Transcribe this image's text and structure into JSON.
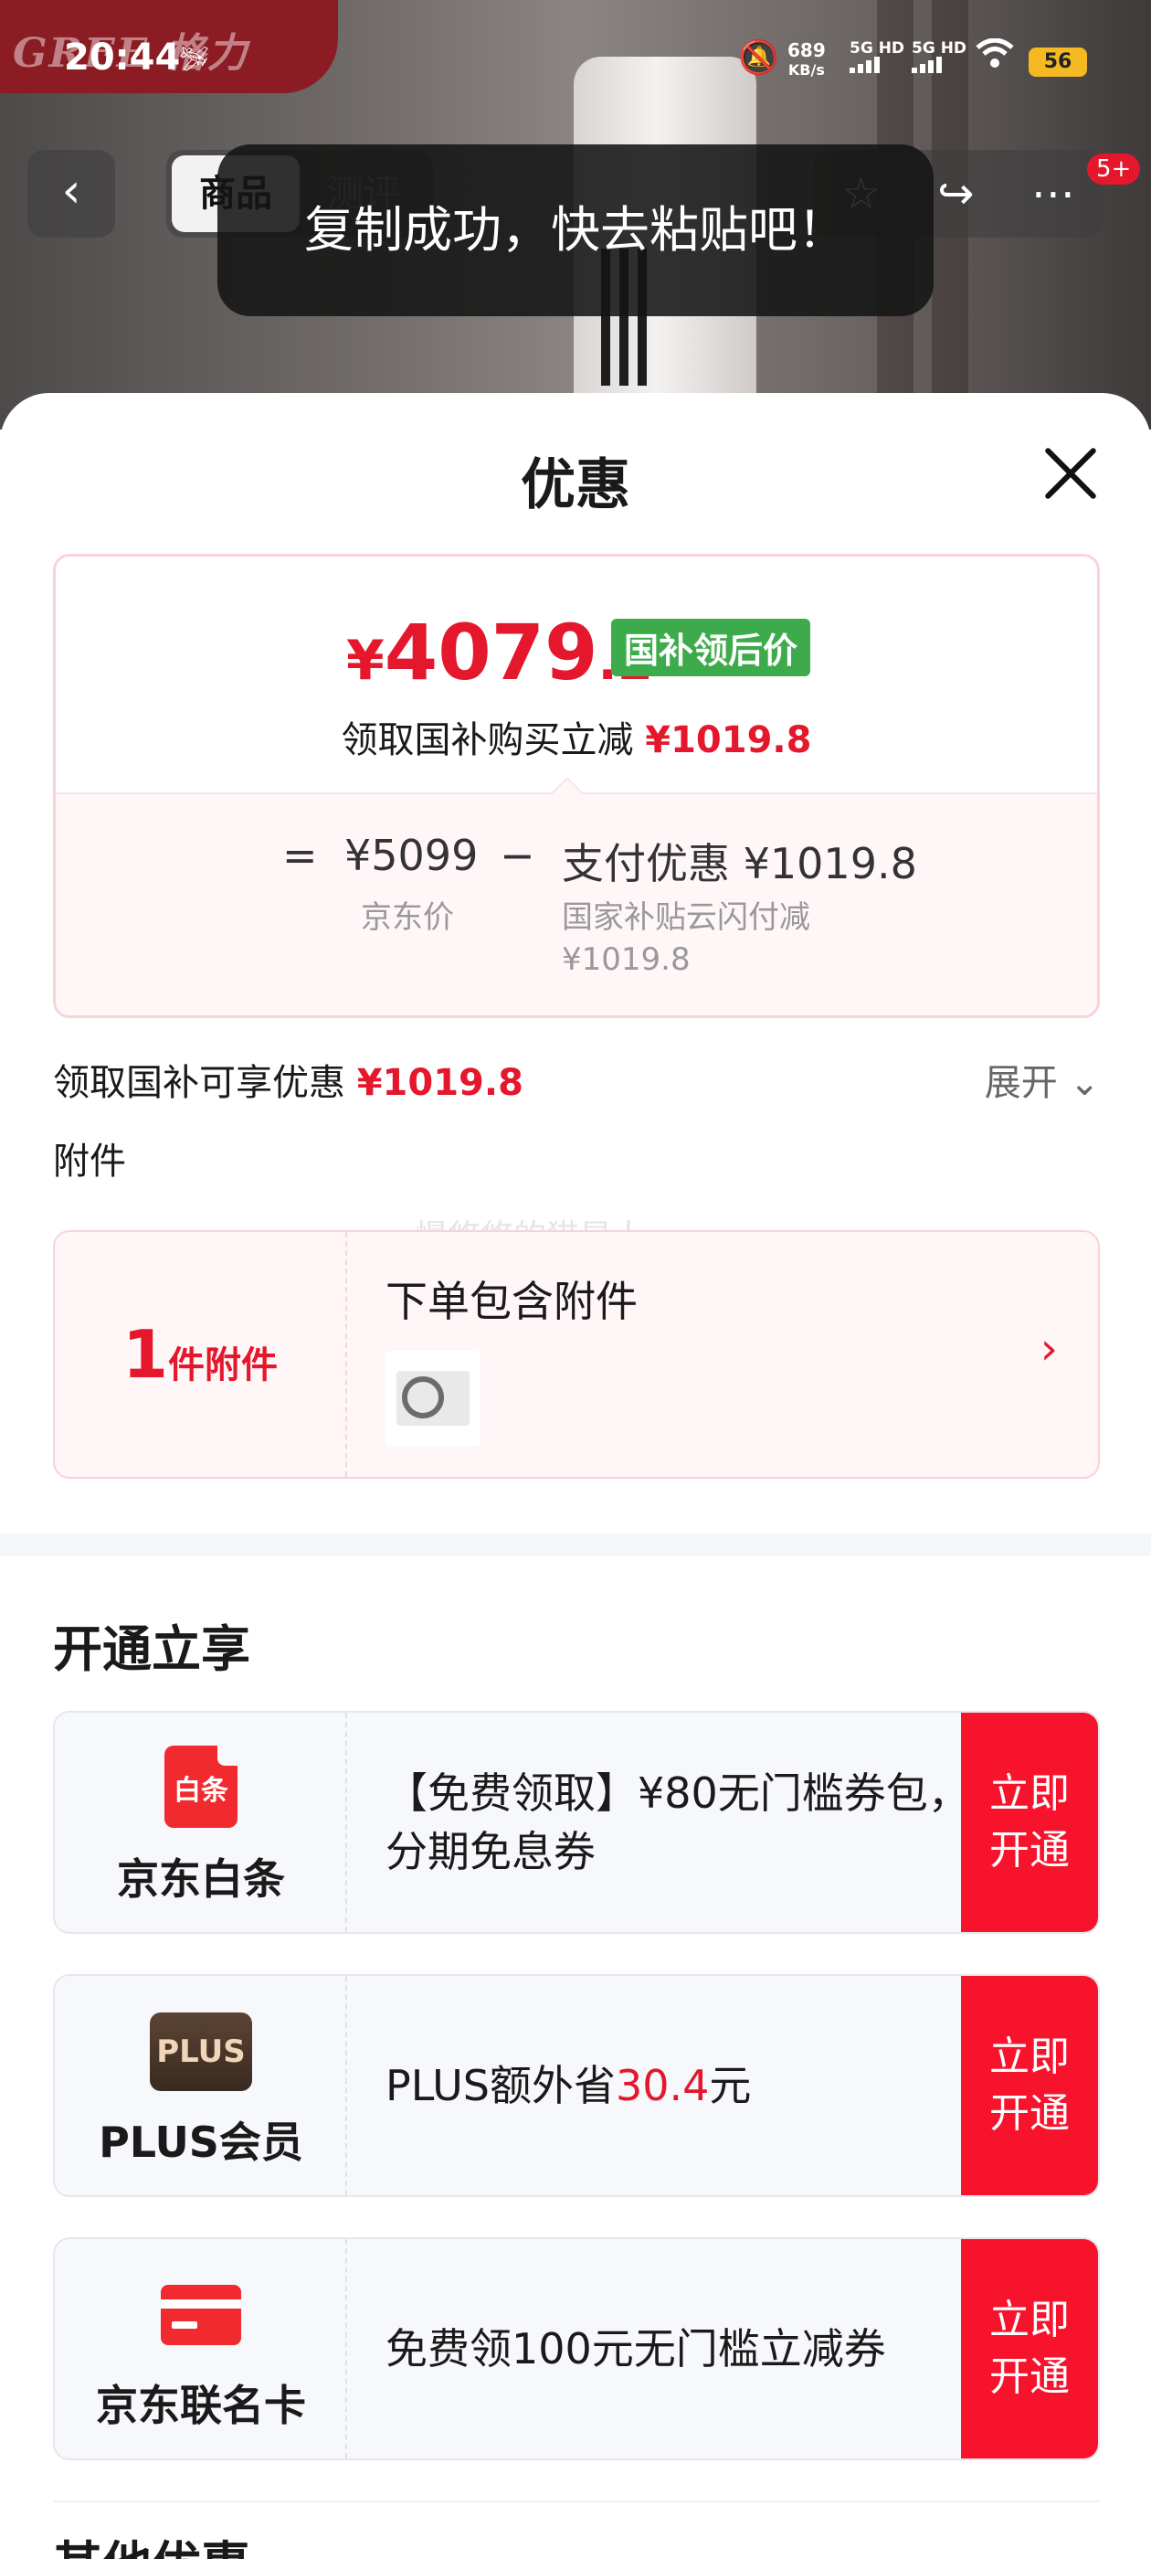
{
  "status_bar": {
    "time": "20:44",
    "net_speed_value": "689",
    "net_speed_unit": "KB/s",
    "sim1": "5G HD",
    "sim2": "5G HD",
    "battery": "56"
  },
  "background": {
    "brand_logo_text": "GREE 格力"
  },
  "nav": {
    "tabs": [
      "商品",
      "测评"
    ],
    "more_badge": "5+"
  },
  "toast": {
    "message": "复制成功，快去粘贴吧！"
  },
  "sheet": {
    "title": "优惠",
    "price_card": {
      "currency": "¥",
      "price_int": "4079",
      "price_dec": ".2",
      "tag": "国补领后价",
      "reduce_text": "领取国补购买立减",
      "reduce_amount": "¥1019.8",
      "calc": {
        "equals": "=",
        "jd_price": "¥5099",
        "minus": "−",
        "payment_label": "支付优惠 ¥1019.8",
        "jd_price_label": "京东价",
        "subsidy_line1": "国家补贴云闪付减",
        "subsidy_line2": "¥1019.8"
      }
    },
    "subsidy_row": {
      "label": "领取国补可享优惠",
      "amount": "¥1019.8",
      "expand": "展开"
    },
    "attachments": {
      "label": "附件",
      "watermark": "慢悠悠的猫星人",
      "count": "1",
      "unit": "件附件",
      "title": "下单包含附件"
    },
    "open_section": {
      "title": "开通立享",
      "offers": [
        {
          "brand_icon_text": "白条",
          "brand": "京东白条",
          "desc": "【免费领取】¥80无门槛券包，分期免息券",
          "desc_highlight": "",
          "desc_suffix": "",
          "cta": "立即开通"
        },
        {
          "brand_icon_text": "PLUS",
          "brand": "PLUS会员",
          "desc": "PLUS额外省",
          "desc_highlight": "30.4",
          "desc_suffix": "元",
          "cta": "立即开通"
        },
        {
          "brand_icon_text": "",
          "brand": "京东联名卡",
          "desc": "免费领100元无门槛立减券",
          "desc_highlight": "",
          "desc_suffix": "",
          "cta": "立即开通"
        }
      ]
    },
    "next_section_title": "其他优惠"
  },
  "icons": {
    "back": "back-arrow-icon",
    "favorite": "star-icon",
    "share": "share-icon",
    "more": "more-dots-icon",
    "close": "close-icon",
    "expand": "chevron-down-icon",
    "attachment_arrow": "chevron-right-icon"
  },
  "colors": {
    "accent_red": "#e4172c",
    "tag_green": "#3dab4b",
    "cta_red": "#f8132d"
  }
}
